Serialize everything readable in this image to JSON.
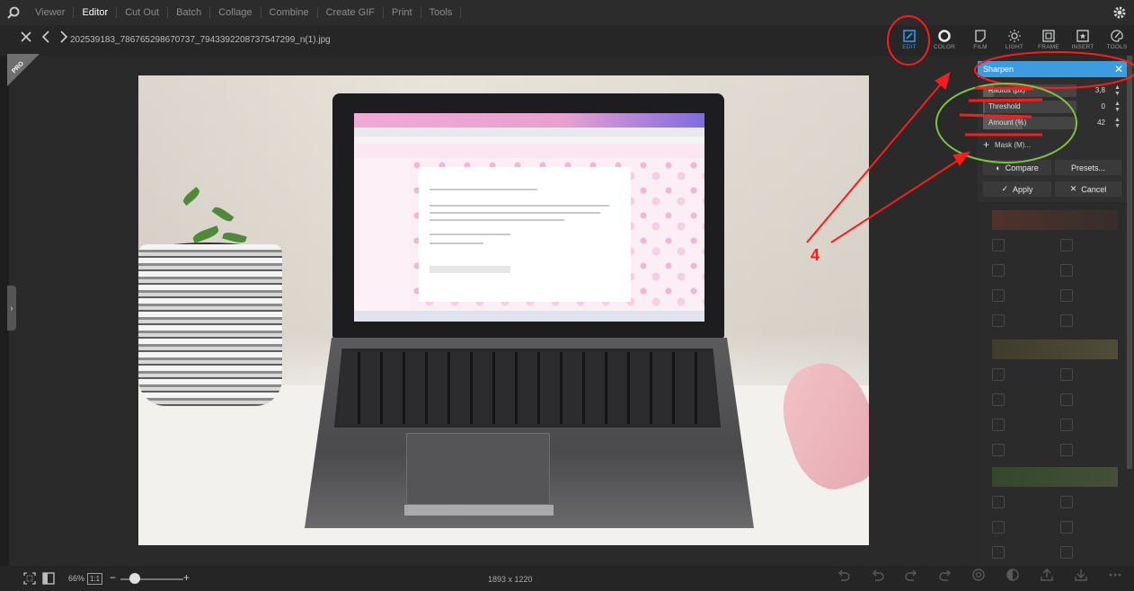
{
  "menu": {
    "items": [
      "Viewer",
      "Editor",
      "Cut Out",
      "Batch",
      "Collage",
      "Combine",
      "Create GIF",
      "Print",
      "Tools"
    ],
    "active": "Editor"
  },
  "file": {
    "name": "202539183_786765298670737_7943392208737547299_n(1).jpg"
  },
  "tools": [
    {
      "label": "EDIT",
      "icon": "edit-icon"
    },
    {
      "label": "COLOR",
      "icon": "color-icon"
    },
    {
      "label": "FILM",
      "icon": "film-icon"
    },
    {
      "label": "LIGHT",
      "icon": "light-icon"
    },
    {
      "label": "FRAME",
      "icon": "frame-icon"
    },
    {
      "label": "INSERT",
      "icon": "insert-icon"
    },
    {
      "label": "TOOLS",
      "icon": "palette-icon"
    }
  ],
  "active_tool": "EDIT",
  "badge": {
    "text": "PRO"
  },
  "dialog": {
    "title": "Sharpen",
    "params": [
      {
        "label": "Radius (px)",
        "value": "3,8",
        "fill": 0.12
      },
      {
        "label": "Threshold",
        "value": "0",
        "fill": 0.02
      },
      {
        "label": "Amount (%)",
        "value": "42",
        "fill": 0.42
      }
    ],
    "mask_label": "Mask (M)...",
    "compare_label": "Compare",
    "presets_label": "Presets...",
    "apply_label": "Apply",
    "cancel_label": "Cancel"
  },
  "annotation": {
    "step": "4",
    "color": "#ff1a1a"
  },
  "bottom": {
    "zoom": "66%",
    "actual_size": "1:1",
    "image_size": "1893 x 1220"
  },
  "colors": {
    "accent": "#3d9be0",
    "background": "#1e1e1e",
    "panel": "#2b2b2b"
  }
}
